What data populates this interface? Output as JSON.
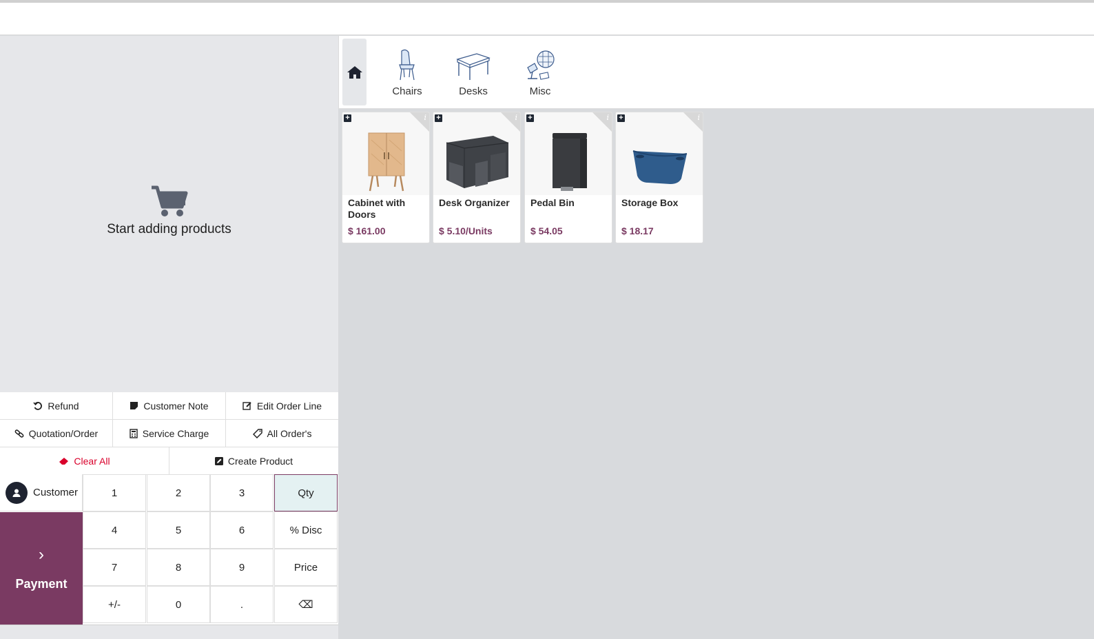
{
  "categories": [
    {
      "label": "Chairs",
      "icon": "chair-icon"
    },
    {
      "label": "Desks",
      "icon": "desk-icon"
    },
    {
      "label": "Misc",
      "icon": "lamp-icon"
    }
  ],
  "order": {
    "empty_message": "Start adding products"
  },
  "actions": {
    "refund": "Refund",
    "customer_note": "Customer Note",
    "edit_order_line": "Edit Order Line",
    "quotation_order": "Quotation/Order",
    "service_charge": "Service Charge",
    "all_orders": "All Order's",
    "clear_all": "Clear All",
    "create_product": "Create Product"
  },
  "numpad": {
    "customer": "Customer",
    "payment": "Payment",
    "keys": [
      "1",
      "2",
      "3",
      "Qty",
      "4",
      "5",
      "6",
      "% Disc",
      "7",
      "8",
      "9",
      "Price",
      "+/-",
      "0",
      ".",
      "⌫"
    ],
    "active_mode": "Qty"
  },
  "products": [
    {
      "name": "Cabinet with Doors",
      "price": "$ 161.00",
      "icon": "cabinet-icon"
    },
    {
      "name": "Desk Organizer",
      "price": "$ 5.10/Units",
      "icon": "desk-organizer-icon"
    },
    {
      "name": "Pedal Bin",
      "price": "$ 54.05",
      "icon": "pedal-bin-icon"
    },
    {
      "name": "Storage Box",
      "price": "$ 18.17",
      "icon": "storage-box-icon"
    }
  ],
  "colors": {
    "brand": "#7a3a62",
    "danger": "#d9002b",
    "active_key_bg": "#e4f1f2"
  }
}
